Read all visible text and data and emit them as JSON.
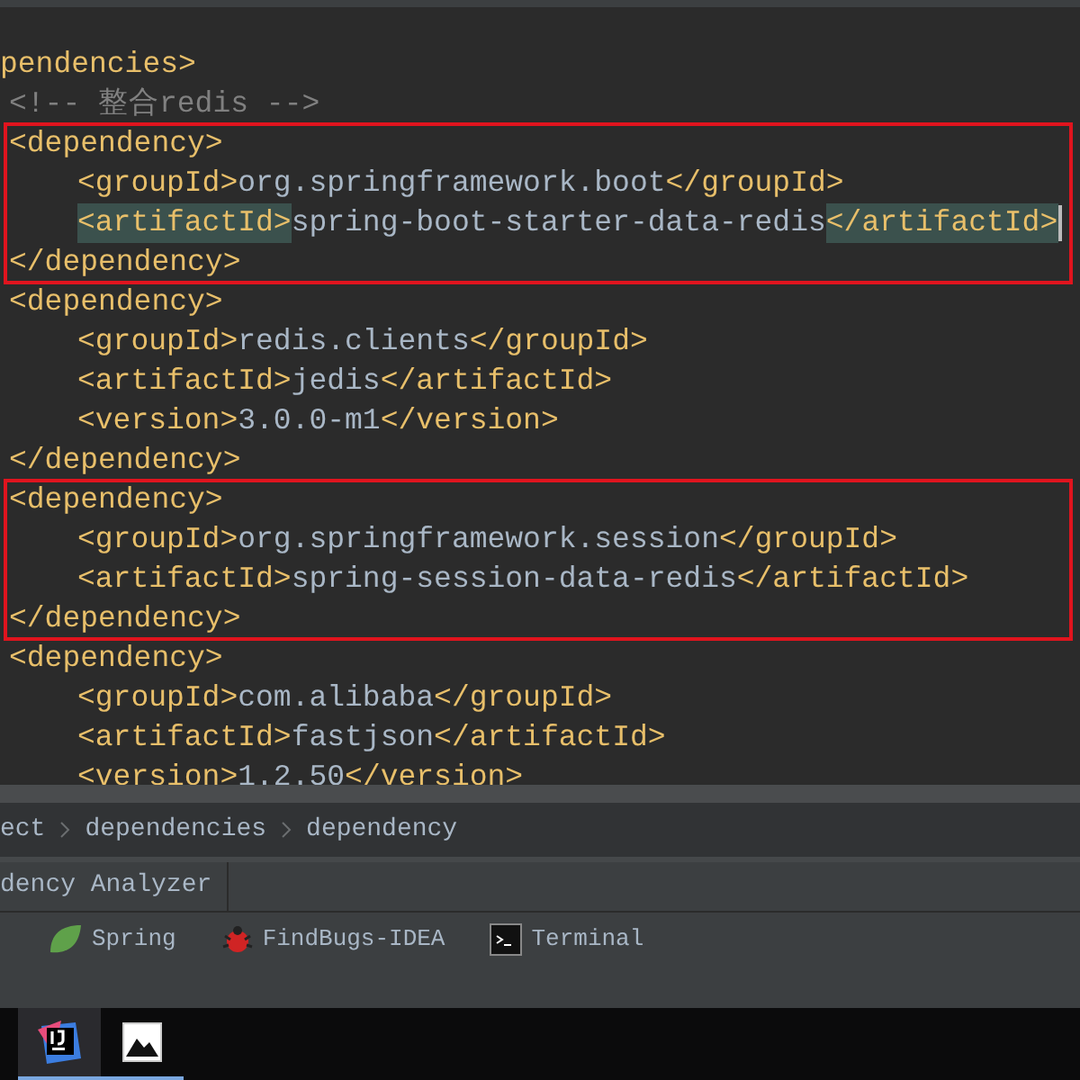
{
  "editor": {
    "lines": [
      {
        "kind": "tag",
        "text": "pendencies>"
      },
      {
        "kind": "comment",
        "text": "<!-- 整合redis -->"
      },
      {
        "kind": "block",
        "open": "<dependency>",
        "close": "</dependency>",
        "annotated": true,
        "children": [
          {
            "open": "<groupId>",
            "value": "org.springframework.boot",
            "close": "</groupId>",
            "tag_match": false
          },
          {
            "open": "<artifactId>",
            "value": "spring-boot-starter-data-redis",
            "close": "</artifactId>",
            "tag_match": true
          }
        ]
      },
      {
        "kind": "block",
        "open": "<dependency>",
        "close": "</dependency>",
        "annotated": false,
        "children": [
          {
            "open": "<groupId>",
            "value": "redis.clients",
            "close": "</groupId>",
            "tag_match": false
          },
          {
            "open": "<artifactId>",
            "value": "jedis",
            "close": "</artifactId>",
            "tag_match": false
          },
          {
            "open": "<version>",
            "value": "3.0.0-m1",
            "close": "</version>",
            "tag_match": false
          }
        ]
      },
      {
        "kind": "block",
        "open": "<dependency>",
        "close": "</dependency>",
        "annotated": true,
        "children": [
          {
            "open": "<groupId>",
            "value": "org.springframework.session",
            "close": "</groupId>",
            "tag_match": false
          },
          {
            "open": "<artifactId>",
            "value": "spring-session-data-redis",
            "close": "</artifactId>",
            "tag_match": false
          }
        ]
      },
      {
        "kind": "block",
        "open": "<dependency>",
        "annotated": false,
        "children": [
          {
            "open": "<groupId>",
            "value": "com.alibaba",
            "close": "</groupId>",
            "tag_match": false
          },
          {
            "open": "<artifactId>",
            "value": "fastjson",
            "close": "</artifactId>",
            "tag_match": false
          },
          {
            "open": "<version>",
            "value": "1.2.50",
            "close": "</version>",
            "tag_match": false
          }
        ]
      }
    ]
  },
  "breadcrumbs": [
    "ect",
    "dependencies",
    "dependency"
  ],
  "editor_tab": {
    "label": "dency Analyzer"
  },
  "tool_windows": [
    {
      "kind": "spring",
      "label": "Spring"
    },
    {
      "kind": "findbugs",
      "label": "FindBugs-IDEA"
    },
    {
      "kind": "terminal",
      "label": "Terminal"
    }
  ],
  "taskbar": [
    {
      "kind": "ide",
      "selected": true
    },
    {
      "kind": "image",
      "selected": false
    }
  ]
}
